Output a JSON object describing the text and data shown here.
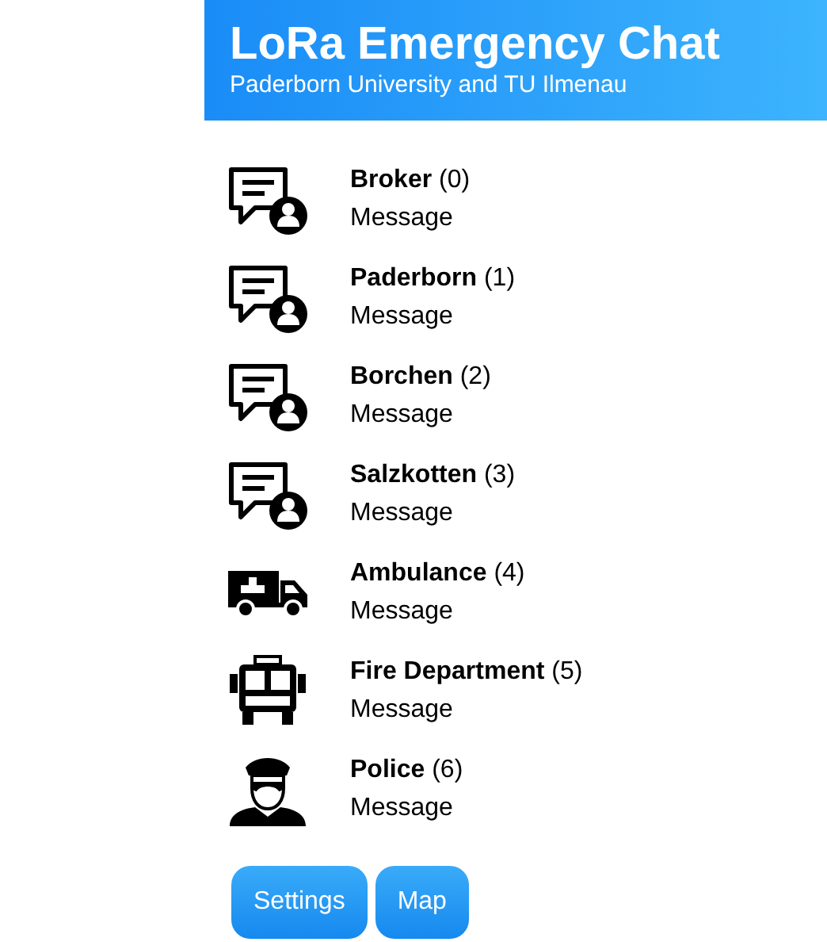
{
  "header": {
    "title": "LoRa Emergency Chat",
    "subtitle": "Paderborn University and TU Ilmenau"
  },
  "contacts": [
    {
      "kind": "chat",
      "name": "**Broker** (0)",
      "message": "Message"
    },
    {
      "kind": "chat",
      "name": "**Paderborn** (1)",
      "message": "Message"
    },
    {
      "kind": "chat",
      "name": "**Borchen** (2)",
      "message": "Message"
    },
    {
      "kind": "chat",
      "name": "**Salzkotten** (3)",
      "message": "Message"
    },
    {
      "kind": "ambulance",
      "name": "**Ambulance** (4)",
      "message": "Message"
    },
    {
      "kind": "fire",
      "name": "**Fire Department** (5)",
      "message": "Message"
    },
    {
      "kind": "police",
      "name": "**Police** (6)",
      "message": "Message"
    }
  ],
  "buttons": [
    "Settings",
    "Map"
  ]
}
